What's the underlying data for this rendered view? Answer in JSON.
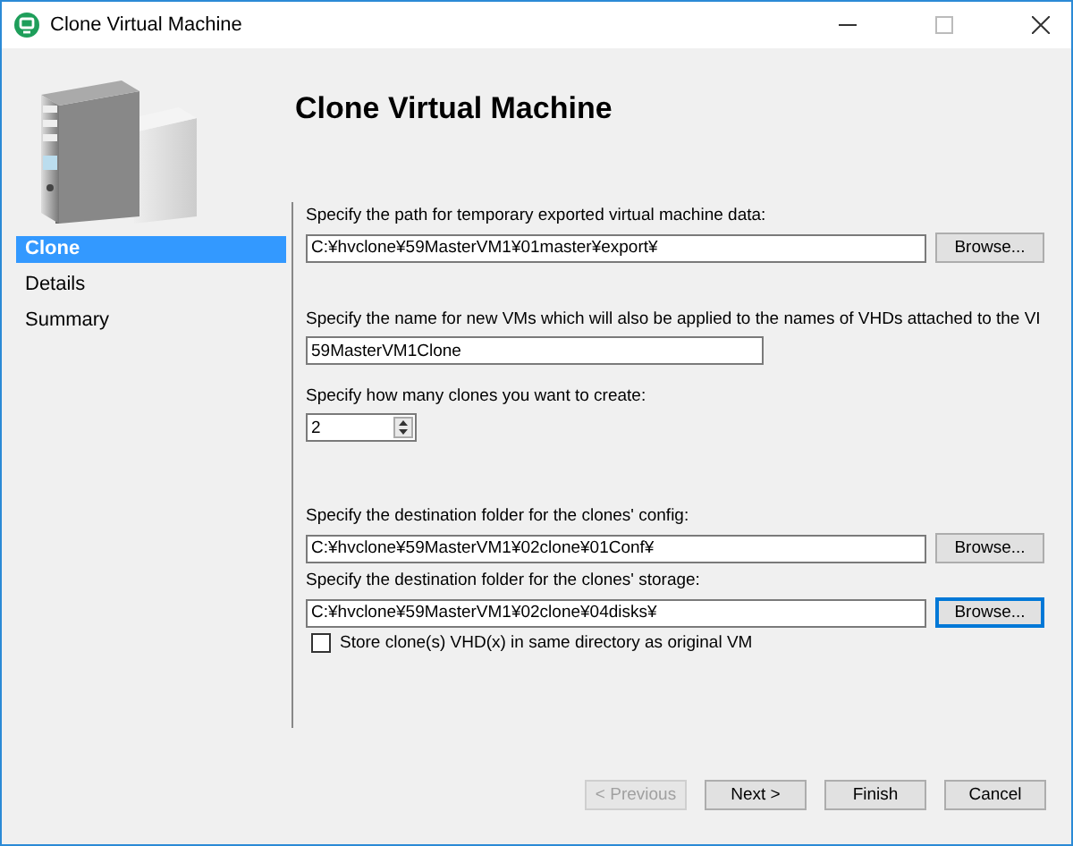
{
  "window": {
    "title": "Clone Virtual Machine"
  },
  "header": {
    "title": "Clone Virtual Machine"
  },
  "steps": [
    {
      "label": "Clone",
      "selected": true
    },
    {
      "label": "Details",
      "selected": false
    },
    {
      "label": "Summary",
      "selected": false
    }
  ],
  "form": {
    "items": [
      {
        "kind": "path",
        "label": "Specify the path for temporary exported virtual machine data:",
        "value": "C:¥hvclone¥59MasterVM1¥01master¥export¥",
        "button": "Browse...",
        "focused": false
      },
      {
        "kind": "text",
        "label": "Specify the name for new VMs which will also be applied to the names of VHDs attached to the VI",
        "value": "59MasterVM1Clone"
      },
      {
        "kind": "spinner",
        "label": "Specify how many clones you want to create:",
        "value": "2"
      },
      {
        "kind": "path",
        "label": "Specify the destination folder for the clones' config:",
        "value": "C:¥hvclone¥59MasterVM1¥02clone¥01Conf¥",
        "button": "Browse...",
        "focused": false
      },
      {
        "kind": "path",
        "label": "Specify the destination folder for the clones' storage:",
        "value": "C:¥hvclone¥59MasterVM1¥02clone¥04disks¥",
        "button": "Browse...",
        "focused": true
      }
    ],
    "checkbox": {
      "label": "Store clone(s) VHD(x) in same directory as original VM",
      "checked": false
    }
  },
  "buttons": [
    {
      "label": "< Previous",
      "disabled": true
    },
    {
      "label": "Next >",
      "disabled": false
    },
    {
      "label": "Finish",
      "disabled": false
    },
    {
      "label": "Cancel",
      "disabled": false
    }
  ]
}
